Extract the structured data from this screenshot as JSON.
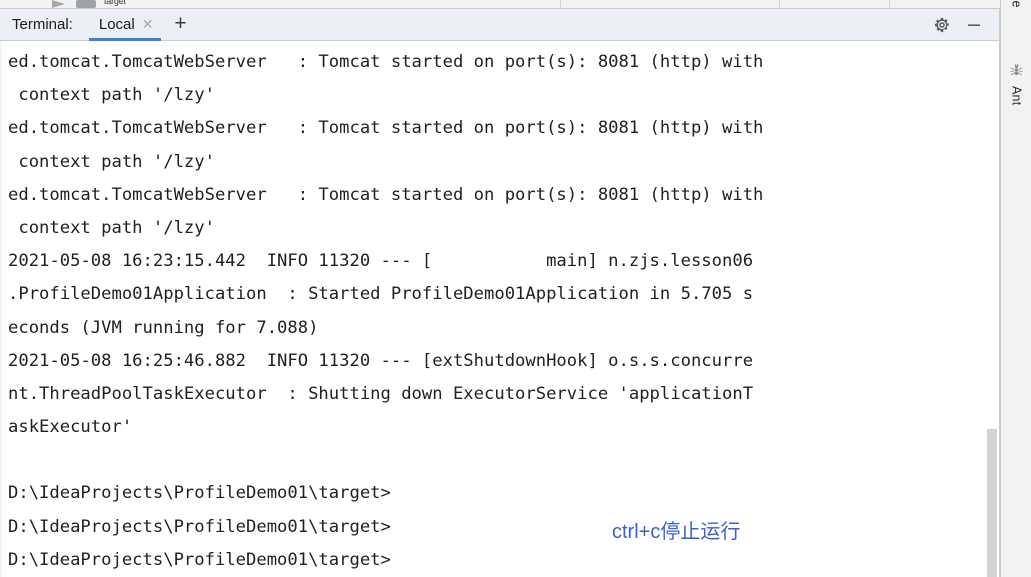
{
  "toolbar": {
    "run_icon": "run-play-icon",
    "stop_icon": "stop-square-icon",
    "partial_text": "target"
  },
  "terminal": {
    "tool_window_label": "Terminal:",
    "tabs": [
      {
        "label": "Local",
        "close_icon": "close-icon",
        "active": true
      }
    ],
    "add_tab_label": "+",
    "settings_icon": "gear-icon",
    "minimize_icon": "minimize-icon",
    "lines": [
      "ed.tomcat.TomcatWebServer   : Tomcat started on port(s): 8081 (http) with",
      " context path '/lzy'",
      "ed.tomcat.TomcatWebServer   : Tomcat started on port(s): 8081 (http) with",
      " context path '/lzy'",
      "ed.tomcat.TomcatWebServer   : Tomcat started on port(s): 8081 (http) with",
      " context path '/lzy'",
      "2021-05-08 16:23:15.442  INFO 11320 --- [           main] n.zjs.lesson06",
      ".ProfileDemo01Application  : Started ProfileDemo01Application in 5.705 s",
      "econds (JVM running for 7.088)",
      "2021-05-08 16:25:46.882  INFO 11320 --- [extShutdownHook] o.s.s.concurre",
      "nt.ThreadPoolTaskExecutor  : Shutting down ExecutorService 'applicationT",
      "askExecutor'",
      "",
      "D:\\IdeaProjects\\ProfileDemo01\\target>",
      "D:\\IdeaProjects\\ProfileDemo01\\target>",
      "D:\\IdeaProjects\\ProfileDemo01\\target>"
    ],
    "annotation": "ctrl+c停止运行",
    "annotation_color": "#3c5fd0"
  },
  "right_strip": {
    "top_partial_label": "se",
    "items": [
      {
        "label": "Ant",
        "icon": "ant-bug-icon"
      }
    ]
  }
}
